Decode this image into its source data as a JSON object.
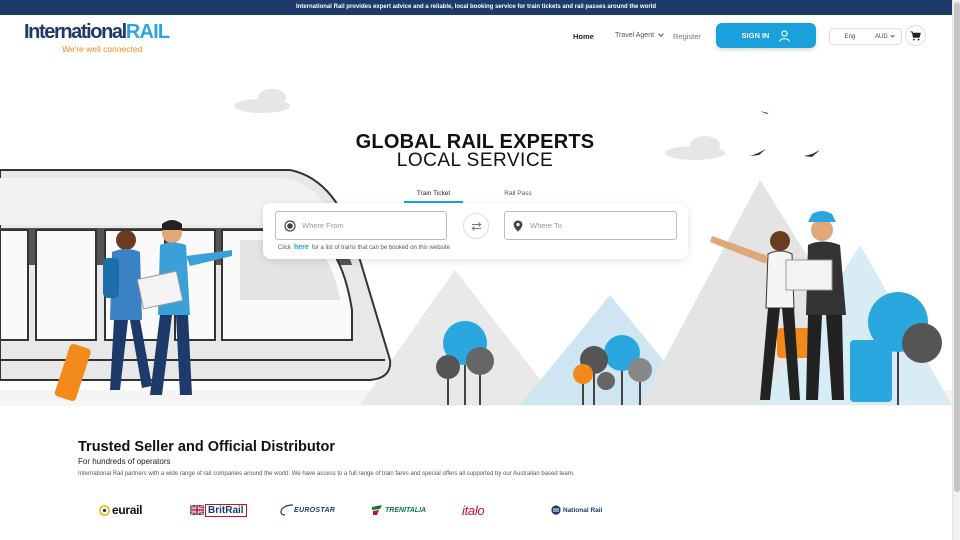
{
  "banner": {
    "text": "International Rail provides expert advice and a reliable, local booking service for train tickets and rail passes around the world"
  },
  "brand": {
    "name_part1": "International",
    "name_part2": "RAIL",
    "tagline": "We're well connected"
  },
  "nav": {
    "home": "Home",
    "travel_agent": "Travel Agent",
    "register": "Register",
    "sign_in": "SIGN IN",
    "language": "Eng",
    "currency": "AUD"
  },
  "hero": {
    "title_line1": "GLOBAL RAIL EXPERTS",
    "title_line2": "LOCAL SERVICE"
  },
  "search": {
    "tabs": [
      {
        "label": "Train Ticket",
        "active": true
      },
      {
        "label": "Rail Pass",
        "active": false
      }
    ],
    "from_placeholder": "Where From",
    "to_placeholder": "Where To",
    "note_prefix": "Click",
    "note_link": "here",
    "note_suffix": "for a list of trains that can be booked on this website"
  },
  "trusted": {
    "title": "Trusted Seller and Official Distributor",
    "subtitle": "For hundreds of operators",
    "description": "International Rail partners with a wide range of rail companies around the world. We have access to a full range of train fares and special offers all supported by our Australian based team."
  },
  "operators": [
    {
      "name": "eurail"
    },
    {
      "name": "BritRail"
    },
    {
      "name": "EUROSTAR"
    },
    {
      "name": "TRENITALIA"
    },
    {
      "name": "italo"
    },
    {
      "name": "National Rail"
    }
  ],
  "colors": {
    "navy": "#1d3a6a",
    "accent_blue": "#1aa1dc",
    "orange": "#f28a1b",
    "trenitalia_green": "#0a7c3e",
    "italo_red": "#c8102e"
  },
  "icons": {
    "user": "user-icon",
    "cart": "cart-icon",
    "swap": "swap-icon",
    "origin": "radio-target-icon",
    "destination": "map-pin-icon"
  }
}
